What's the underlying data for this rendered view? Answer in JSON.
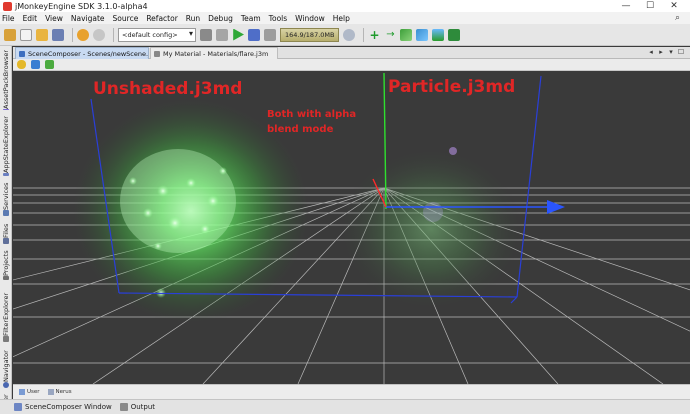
{
  "window": {
    "title": "jMonkeyEngine SDK 3.1.0-alpha4",
    "controls": {
      "minimize": "—",
      "maximize": "☐",
      "close": "✕"
    }
  },
  "menu": {
    "items": [
      "File",
      "Edit",
      "View",
      "Navigate",
      "Source",
      "Refactor",
      "Run",
      "Debug",
      "Team",
      "Tools",
      "Window",
      "Help"
    ],
    "search_icon": "search-icon"
  },
  "toolbar": {
    "config_value": "<default config>",
    "memory": "164.9/187.0MB"
  },
  "sidebar": {
    "tabs": [
      "AssetPackBrowser",
      "AppStateExplorer",
      "Services",
      "Files",
      "Projects",
      "FilterExplorer",
      "Navigator",
      "er"
    ]
  },
  "editor": {
    "tabs": [
      {
        "label": "SceneComposer - Scenes/newScene.j3o"
      },
      {
        "label": "My Material - Materials/flare.j3m"
      }
    ],
    "nav": {
      "left": "◂",
      "right": "▸",
      "list": "▾",
      "restore": "☐"
    }
  },
  "viewport": {
    "annotation_left": "Unshaded.j3md",
    "annotation_right": "Particle.j3md",
    "annotation_note_line1": "Both with alpha",
    "annotation_note_line2": "blend mode",
    "colors": {
      "grid": "#d0d0d0",
      "axis_x": "#2a55ff",
      "axis_y": "#2ee02e",
      "axis_z": "#ff2a2a",
      "glow": "#6bff6b",
      "annotation": "#e02626"
    }
  },
  "bottom_panel": {
    "items": [
      "User",
      "Nerus"
    ]
  },
  "statusbar": {
    "items": [
      "SceneComposer Window",
      "Output"
    ]
  }
}
